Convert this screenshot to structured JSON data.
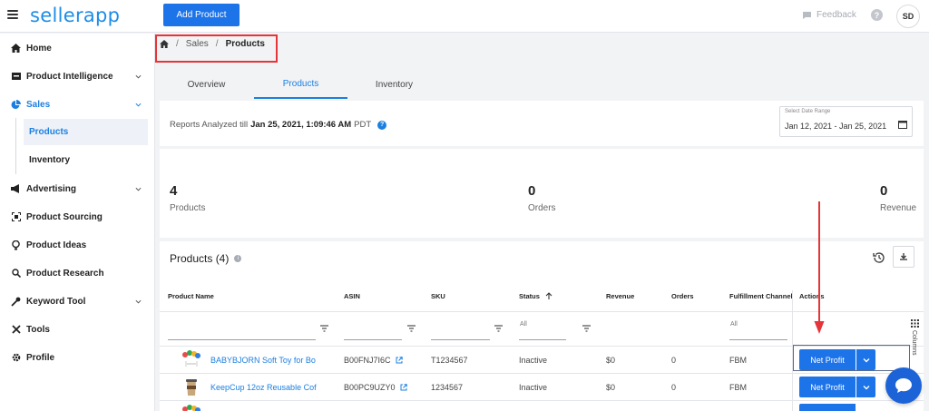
{
  "header": {
    "logo": "sellerapp",
    "add_product_label": "Add Product",
    "feedback_label": "Feedback",
    "avatar_initials": "SD"
  },
  "sidebar": {
    "items": [
      {
        "label": "Home",
        "icon": "home-icon"
      },
      {
        "label": "Product Intelligence",
        "icon": "box-icon"
      },
      {
        "label": "Sales",
        "icon": "pie-chart-icon"
      },
      {
        "label": "Advertising",
        "icon": "megaphone-icon"
      },
      {
        "label": "Product Sourcing",
        "icon": "sourcing-icon"
      },
      {
        "label": "Product Ideas",
        "icon": "bulb-icon"
      },
      {
        "label": "Product Research",
        "icon": "search-icon"
      },
      {
        "label": "Keyword Tool",
        "icon": "key-icon"
      },
      {
        "label": "Tools",
        "icon": "tools-icon"
      },
      {
        "label": "Profile",
        "icon": "gear-icon"
      }
    ],
    "sub_items": [
      {
        "label": "Products"
      },
      {
        "label": "Inventory"
      }
    ]
  },
  "breadcrumb": {
    "sales": "Sales",
    "current": "Products",
    "sep": "/"
  },
  "tabs": [
    {
      "label": "Overview"
    },
    {
      "label": "Products"
    },
    {
      "label": "Inventory"
    }
  ],
  "report": {
    "prefix": "Reports Analyzed till",
    "timestamp": "Jan 25, 2021, 1:09:46 AM",
    "tz": "PDT",
    "date_range_legend": "Select Date Range",
    "date_range_value": "Jan 12, 2021 - Jan 25, 2021"
  },
  "stats": [
    {
      "value": "4",
      "label": "Products"
    },
    {
      "value": "0",
      "label": "Orders"
    },
    {
      "value": "0",
      "label": "Revenue"
    }
  ],
  "products": {
    "title": "Products (4)",
    "columns": [
      "Product Name",
      "ASIN",
      "SKU",
      "Status",
      "Revenue",
      "Orders",
      "Fulfillment Channel",
      "Actions"
    ],
    "filters": {
      "status": "All",
      "fulfillment": "All"
    },
    "rows": [
      {
        "name": "BABYBJORN Soft Toy for Bo",
        "asin": "B00FNJ7I6C",
        "sku": "T1234567",
        "status": "Inactive",
        "revenue": "$0",
        "orders": "0",
        "channel": "FBM",
        "action": "Net Profit"
      },
      {
        "name": "KeepCup 12oz Reusable Cof",
        "asin": "B00PC9UZY0",
        "sku": "1234567",
        "status": "Inactive",
        "revenue": "$0",
        "orders": "0",
        "channel": "FBM",
        "action": "Net Profit"
      }
    ],
    "columns_toggle": "Columns"
  },
  "colors": {
    "brand": "#1c8de8",
    "primary_button": "#1d73e8",
    "highlight": "#e5353a"
  }
}
